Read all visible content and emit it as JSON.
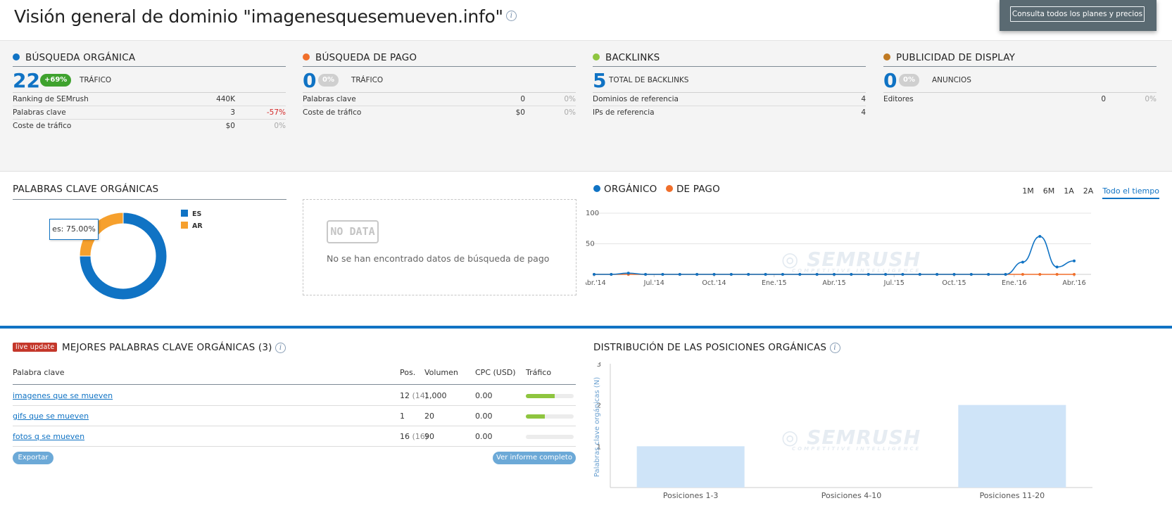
{
  "header": {
    "title": "Visión general de dominio \"imagenesquesemueven.info\"",
    "popup_button": "Consulta todos los planes y precios"
  },
  "colors": {
    "organic": "#1073c4",
    "paid": "#f06f2b",
    "backlinks": "#8ec53f",
    "display": "#c07a23",
    "accent_blue": "#1073c4",
    "ar_orange": "#f6a02d"
  },
  "summary": {
    "organic": {
      "title": "BÚSQUEDA ORGÁNICA",
      "big_value": "22",
      "badge": "+69%",
      "big_label": "TRÁFICO",
      "rows": [
        {
          "label": "Ranking de SEMrush",
          "value": "440K",
          "change": ""
        },
        {
          "label": "Palabras clave",
          "value": "3",
          "change": "-57%"
        },
        {
          "label": "Coste de tráfico",
          "value": "$0",
          "change": "0%"
        }
      ]
    },
    "paid": {
      "title": "BÚSQUEDA DE PAGO",
      "big_value": "0",
      "badge": "0%",
      "big_label": "TRÁFICO",
      "rows": [
        {
          "label": "Palabras clave",
          "value": "0",
          "change": "0%"
        },
        {
          "label": "Coste de tráfico",
          "value": "$0",
          "change": "0%"
        }
      ]
    },
    "backlinks": {
      "title": "BACKLINKS",
      "big_value": "5",
      "big_label": "TOTAL DE BACKLINKS",
      "rows": [
        {
          "label": "Dominios de referencia",
          "value": "4"
        },
        {
          "label": "IPs de referencia",
          "value": "4"
        }
      ]
    },
    "display": {
      "title": "PUBLICIDAD DE DISPLAY",
      "big_value": "0",
      "badge": "0%",
      "big_label": "ANUNCIOS",
      "rows": [
        {
          "label": "Editores",
          "value": "0",
          "change": "0%"
        }
      ]
    }
  },
  "organic_keywords": {
    "title": "PALABRAS CLAVE ORGÁNICAS",
    "tooltip": "es: 75.00%",
    "chart_data": {
      "type": "pie",
      "categories": [
        "ES",
        "AR"
      ],
      "values": [
        75,
        25
      ],
      "colors": [
        "#1073c4",
        "#f6a02d"
      ],
      "legend_position": "right"
    }
  },
  "nodata": {
    "logo": "NO DATA",
    "text": "No se han encontrado datos de búsqueda de pago"
  },
  "trend": {
    "legend_organic": "ORGÁNICO",
    "legend_paid": "DE PAGO",
    "tabs": [
      "1M",
      "6M",
      "1A",
      "2A",
      "Todo el tiempo"
    ],
    "active_tab": "Todo el tiempo",
    "watermark": "SEMRUSH",
    "watermark_sub": "COMPETITIVE INTELLIGENCE",
    "chart_data": {
      "type": "line",
      "x_labels": [
        "Abr.'14",
        "Jul.'14",
        "Oct.'14",
        "Ene.'15",
        "Abr.'15",
        "Jul.'15",
        "Oct.'15",
        "Ene.'16",
        "Abr.'16"
      ],
      "ylim": [
        0,
        100
      ],
      "yticks": [
        50,
        100
      ],
      "series": [
        {
          "name": "ORGÁNICO",
          "color": "#1073c4",
          "values": [
            0,
            0,
            2,
            0,
            0,
            0,
            0,
            0,
            0,
            0,
            0,
            0,
            0,
            0,
            0,
            0,
            0,
            0,
            0,
            0,
            0,
            0,
            0,
            0,
            0,
            20,
            62,
            12,
            22
          ]
        },
        {
          "name": "DE PAGO",
          "color": "#f06f2b",
          "values": [
            0,
            0,
            0,
            0,
            0,
            0,
            0,
            0,
            0,
            0,
            0,
            0,
            0,
            0,
            0,
            0,
            0,
            0,
            0,
            0,
            0,
            0,
            0,
            0,
            0,
            0,
            0,
            0,
            0
          ]
        }
      ]
    }
  },
  "top_keywords": {
    "badge": "live update",
    "title": "MEJORES PALABRAS CLAVE ORGÁNICAS (3)",
    "columns": [
      "Palabra clave",
      "Pos.",
      "Volumen",
      "CPC (USD)",
      "Tráfico"
    ],
    "rows": [
      {
        "keyword": "imagenes que se mueven",
        "pos": "12",
        "prev": "(14)",
        "volume": "1,000",
        "cpc": "0.00",
        "traffic": 0.6
      },
      {
        "keyword": "gifs que se mueven",
        "pos": "1",
        "prev": "",
        "volume": "20",
        "cpc": "0.00",
        "traffic": 0.4
      },
      {
        "keyword": "fotos q se mueven",
        "pos": "16",
        "prev": "(16)",
        "volume": "90",
        "cpc": "0.00",
        "traffic": 0.0
      }
    ],
    "export_button": "Exportar",
    "report_button": "Ver informe completo"
  },
  "distribution": {
    "title": "DISTRIBUCIÓN DE LAS POSICIONES ORGÁNICAS",
    "chart_data": {
      "type": "bar",
      "categories": [
        "Posiciones 1-3",
        "Posiciones 4-10",
        "Posiciones 11-20"
      ],
      "values": [
        1,
        0,
        2
      ],
      "ylabel": "Palabras clave orgánicas (N)",
      "ylim": [
        0,
        3
      ],
      "yticks": [
        1,
        2,
        3
      ],
      "color": "#cfe4f8"
    }
  }
}
